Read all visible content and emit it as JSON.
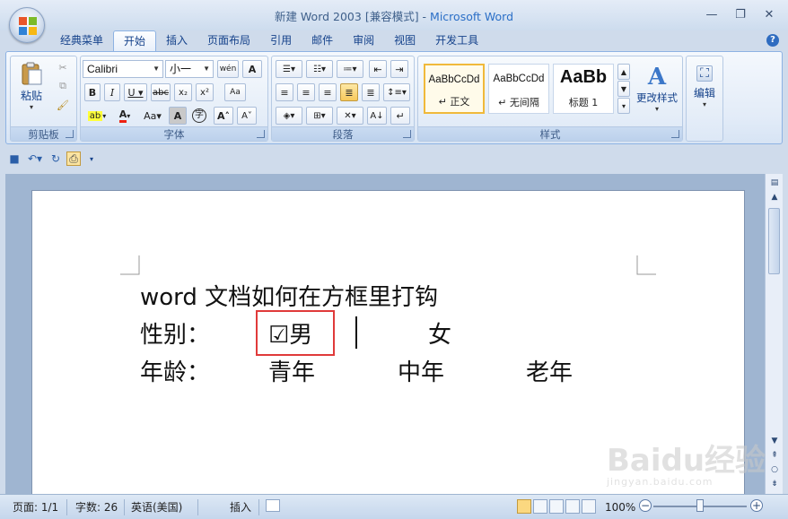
{
  "window": {
    "title_doc": "新建 Word 2003 [兼容模式]",
    "title_sep": " - ",
    "title_app": "Microsoft Word"
  },
  "tabs": [
    {
      "label": "经典菜单"
    },
    {
      "label": "开始",
      "active": true
    },
    {
      "label": "插入"
    },
    {
      "label": "页面布局"
    },
    {
      "label": "引用"
    },
    {
      "label": "邮件"
    },
    {
      "label": "审阅"
    },
    {
      "label": "视图"
    },
    {
      "label": "开发工具"
    }
  ],
  "ribbon": {
    "clipboard": {
      "label": "剪贴板",
      "paste_label": "粘贴"
    },
    "font": {
      "label": "字体",
      "font_name": "Calibri",
      "font_size": "小一"
    },
    "paragraph": {
      "label": "段落"
    },
    "styles": {
      "label": "样式",
      "items": [
        {
          "sample": "AaBbCcDd",
          "name": "↵ 正文"
        },
        {
          "sample": "AaBbCcDd",
          "name": "↵ 无间隔"
        },
        {
          "sample": "AaBb",
          "name": "标题 1"
        }
      ],
      "change_styles_label": "更改样式"
    },
    "editing": {
      "label": "编辑"
    }
  },
  "document": {
    "line1": "word 文档如何在方框里打钩",
    "gender_label": "性别：",
    "male_option": "☑男",
    "female_option": "女",
    "age_label": "年龄：",
    "age_options": [
      "青年",
      "中年",
      "老年"
    ]
  },
  "statusbar": {
    "page": "页面: 1/1",
    "words": "字数: 26",
    "language": "英语(美国)",
    "insert_mode": "插入",
    "zoom": "100%"
  },
  "watermark": {
    "brand": "Baidu经验",
    "url": "jingyan.baidu.com"
  },
  "colors": {
    "ribbon_border": "#8db2e3",
    "highlight": "#e03a3a",
    "app_title": "#2b6fc7"
  }
}
